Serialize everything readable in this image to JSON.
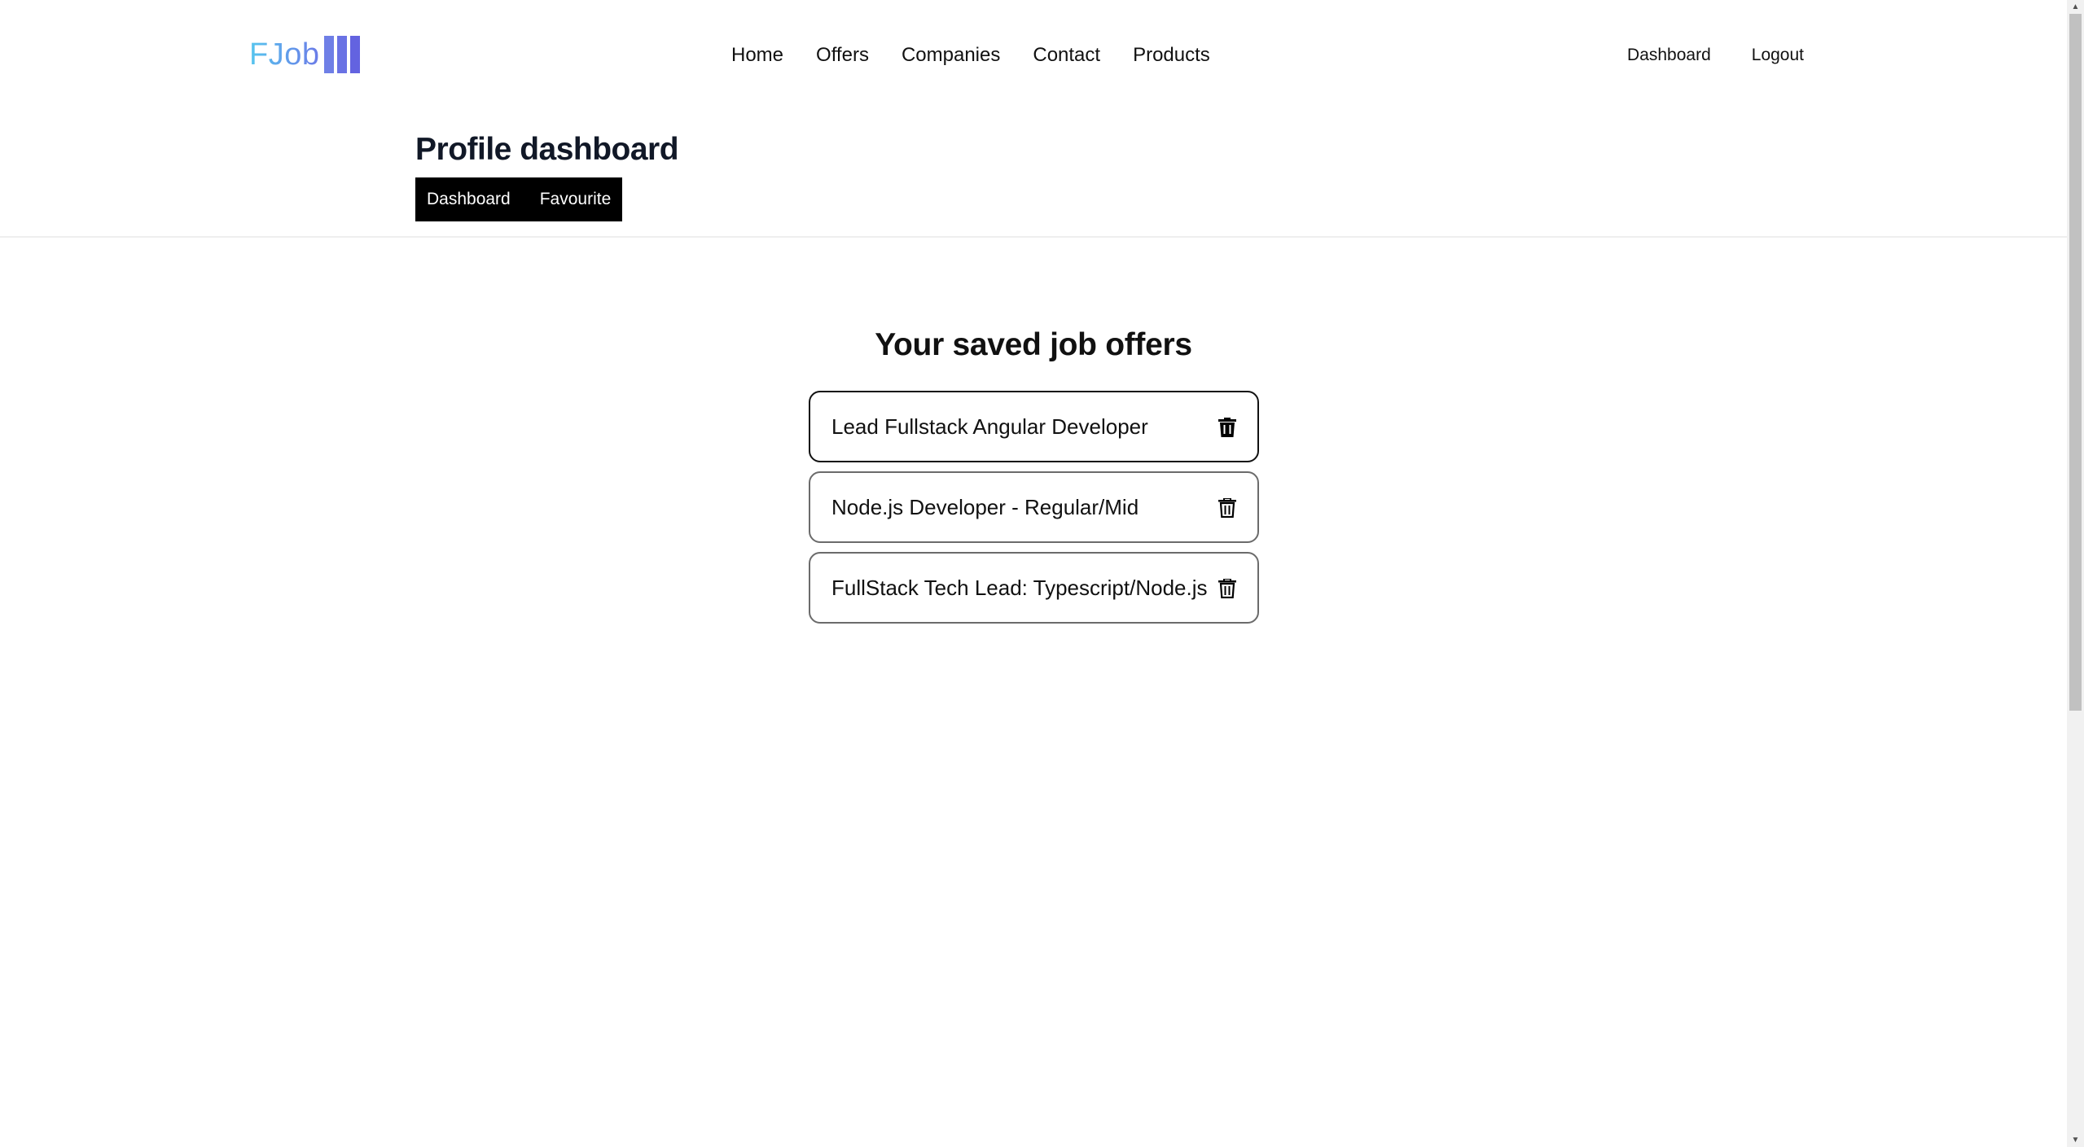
{
  "brand": {
    "logo_text": "FJob",
    "logo_colors": [
      "#56c6ee",
      "#6b7be8",
      "#6363e0"
    ]
  },
  "nav": {
    "main": [
      {
        "label": "Home"
      },
      {
        "label": "Offers"
      },
      {
        "label": "Companies"
      },
      {
        "label": "Contact"
      },
      {
        "label": "Products"
      }
    ],
    "user": {
      "dashboard_label": "Dashboard",
      "logout_label": "Logout"
    }
  },
  "profile": {
    "title": "Profile dashboard",
    "tabs": {
      "dashboard_label": "Dashboard",
      "favourite_label": "Favourite"
    }
  },
  "saved": {
    "title": "Your saved job offers",
    "offers": [
      {
        "title": "Lead Fullstack Angular Developer",
        "delete_icon": "trash-icon"
      },
      {
        "title": "Node.js Developer - Regular/Mid",
        "delete_icon": "trash-icon"
      },
      {
        "title": "FullStack Tech Lead: Typescript/Node.js",
        "delete_icon": "trash-icon"
      }
    ]
  }
}
